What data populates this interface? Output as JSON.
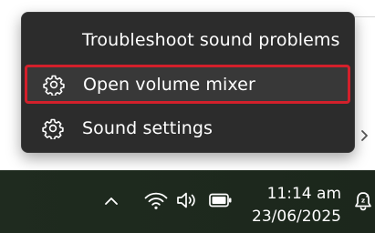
{
  "menu": {
    "items": [
      {
        "label": "Troubleshoot sound problems",
        "icon": "none"
      },
      {
        "label": "Open volume mixer",
        "icon": "gear-icon",
        "highlighted": true
      },
      {
        "label": "Sound settings",
        "icon": "gear-icon"
      }
    ]
  },
  "taskbar": {
    "time": "11:14 am",
    "date": "23/06/2025",
    "icons": [
      "chevron-up-icon",
      "wifi-icon",
      "speaker-icon",
      "battery-icon",
      "notification-icon"
    ]
  },
  "colors": {
    "menu_bg": "#2c2c2c",
    "highlight_border": "#d3202b",
    "taskbar_bg": "#1f2b1f",
    "text": "#ffffff"
  }
}
